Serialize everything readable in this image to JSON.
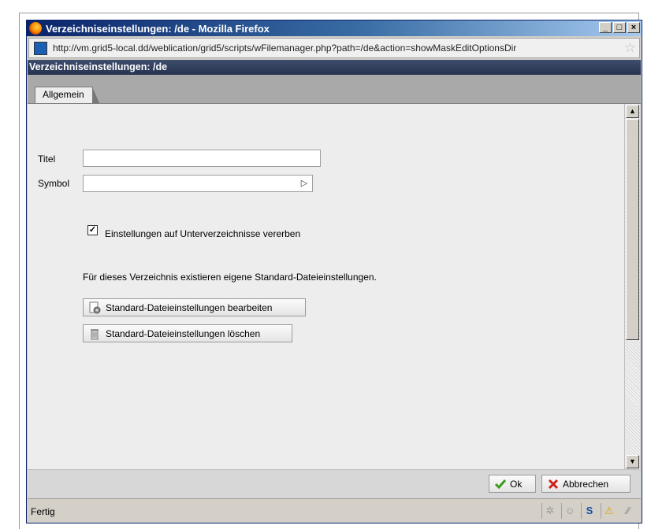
{
  "window": {
    "title": "Verzeichniseinstellungen: /de - Mozilla Firefox",
    "url": "http://vm.grid5-local.dd/weblication/grid5/scripts/wFilemanager.php?path=/de&action=showMaskEditOptionsDir"
  },
  "dialog": {
    "header": "Verzeichniseinstellungen: /de",
    "tabs": [
      {
        "label": "Allgemein",
        "active": true
      }
    ],
    "form": {
      "title_label": "Titel",
      "title_value": "",
      "symbol_label": "Symbol",
      "symbol_value": "",
      "inherit_checked": true,
      "inherit_label": "Einstellungen auf Unterverzeichnisse vererben",
      "info_text": "Für dieses Verzeichnis existieren eigene Standard-Dateieinstellungen.",
      "edit_button": "Standard-Dateieinstellungen bearbeiten",
      "delete_button": "Standard-Dateieinstellungen löschen"
    },
    "footer": {
      "ok": "Ok",
      "cancel": "Abbrechen"
    }
  },
  "statusbar": {
    "text": "Fertig"
  },
  "colors": {
    "title_gradient_start": "#0a246a",
    "dialog_header": "#2f3c5a",
    "ok_check": "#3a9a1a",
    "cancel_x": "#d0201a"
  }
}
